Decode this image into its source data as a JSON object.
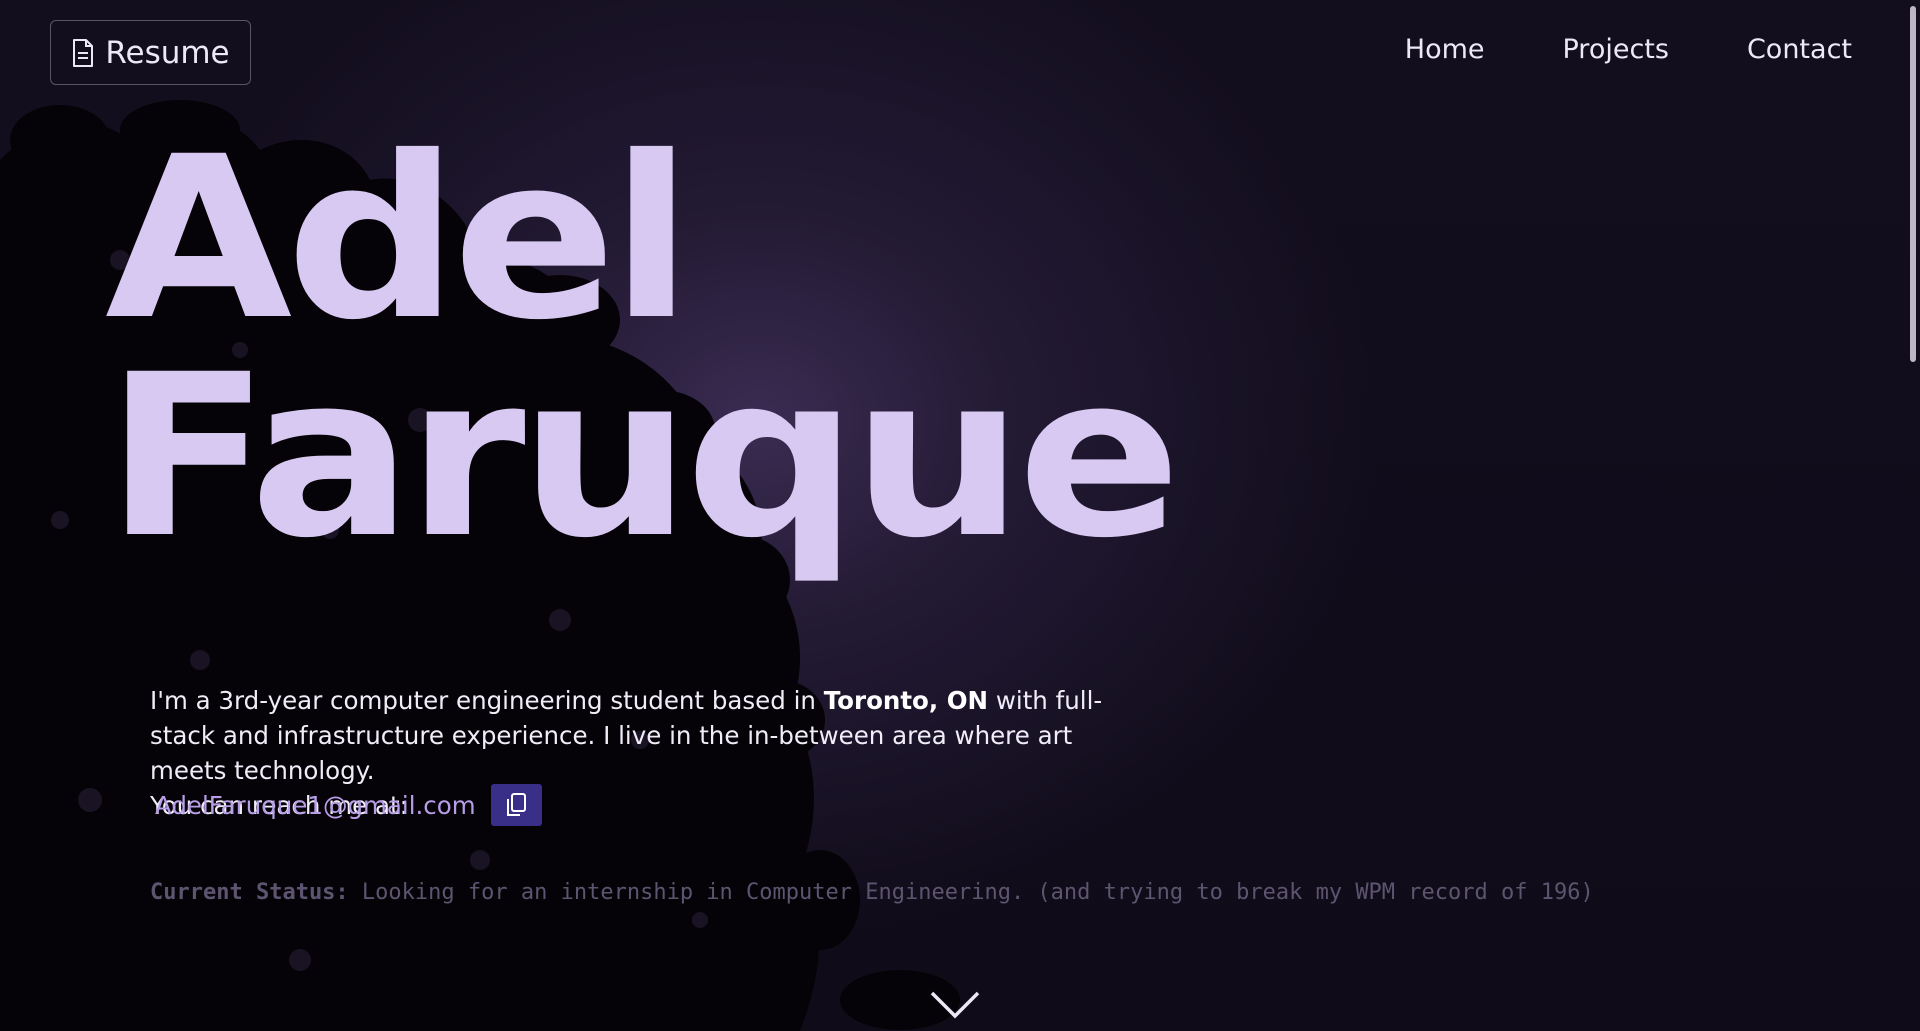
{
  "header": {
    "resume_label": "Resume",
    "nav": [
      "Home",
      "Projects",
      "Contact"
    ]
  },
  "hero": {
    "first_name": "Adel",
    "last_name": "Faruque",
    "bio_part1": "I'm a 3rd-year computer engineering student based in ",
    "bio_location": "Toronto, ON",
    "bio_part2": " with full-stack and infrastructure experience. I live in the in-between area where art meets technology.",
    "reach_label": "You can reach me at:",
    "email": "AdelFaruque1@gmail.com",
    "status_label": "Current Status:",
    "status_text": " Looking for an internship in Computer Engineering. (and trying to break my WPM record of 196)"
  },
  "icons": {
    "resume": "document-icon",
    "copy": "copy-icon",
    "scroll": "chevron-down-icon"
  },
  "colors": {
    "background": "#100c1a",
    "name": "#d8c9f2",
    "email": "#b69de6",
    "copy_button": "#3a2f88",
    "status": "#5d5570"
  }
}
